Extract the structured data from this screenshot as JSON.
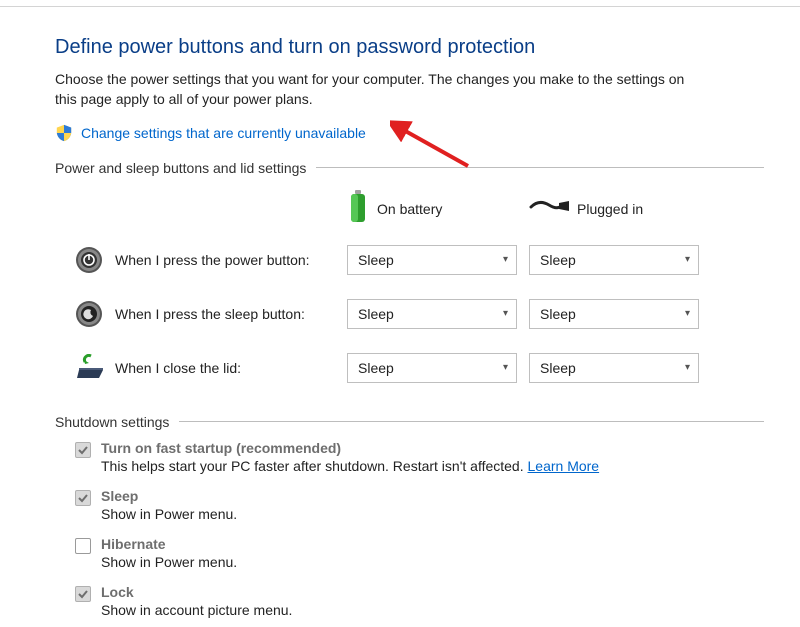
{
  "title": "Define power buttons and turn on password protection",
  "description": "Choose the power settings that you want for your computer. The changes you make to the settings on this page apply to all of your power plans.",
  "admin_link": "Change settings that are currently unavailable",
  "sections": {
    "buttons": {
      "header": "Power and sleep buttons and lid settings"
    },
    "shutdown": {
      "header": "Shutdown settings"
    }
  },
  "columns": {
    "battery": "On battery",
    "plugged": "Plugged in"
  },
  "rows": {
    "power": {
      "label": "When I press the power button:",
      "battery": "Sleep",
      "plugged": "Sleep"
    },
    "sleep": {
      "label": "When I press the sleep button:",
      "battery": "Sleep",
      "plugged": "Sleep"
    },
    "lid": {
      "label": "When I close the lid:",
      "battery": "Sleep",
      "plugged": "Sleep"
    }
  },
  "shutdown": {
    "fast": {
      "title": "Turn on fast startup (recommended)",
      "desc": "This helps start your PC faster after shutdown. Restart isn't affected. ",
      "learn": "Learn More"
    },
    "sleep": {
      "title": "Sleep",
      "desc": "Show in Power menu."
    },
    "hibernate": {
      "title": "Hibernate",
      "desc": "Show in Power menu."
    },
    "lock": {
      "title": "Lock",
      "desc": "Show in account picture menu."
    }
  }
}
